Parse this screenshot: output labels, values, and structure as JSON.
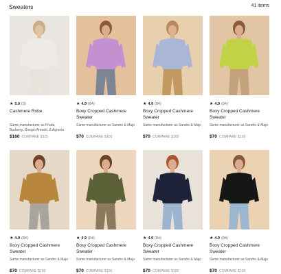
{
  "header": {
    "title": "Sweaters",
    "count": "41 items"
  },
  "products": [
    {
      "score": "5.0",
      "reviews": "(3)",
      "name": "Cashmere Robe",
      "manufacturer": "Same manufacturer as Prada, Burberry, Giorgio Armani, & Agnona",
      "price": "$160",
      "compare": "COMPARE $325",
      "colors": {
        "bg": "#e9e6e2",
        "garment": "#eeebe6",
        "skin": "#e3c1a6",
        "hair": "#c9ad87",
        "pants": "#e7e3dd"
      }
    },
    {
      "score": "4.9",
      "reviews": "(84)",
      "name": "Boxy Cropped Cashmere Sweater",
      "manufacturer": "Same manufacturer as Sandro & Majo",
      "price": "$70",
      "compare": "COMPARE $100",
      "colors": {
        "bg": "#e4c19c",
        "garment": "#c391cf",
        "skin": "#d9ad8d",
        "hair": "#8a5a3a",
        "pants": "#7b8593"
      }
    },
    {
      "score": "4.9",
      "reviews": "(84)",
      "name": "Boxy Cropped Cashmere Sweater",
      "manufacturer": "Same manufacturer as Sandro & Majo",
      "price": "$70",
      "compare": "COMPARE $100",
      "colors": {
        "bg": "#e8cfae",
        "garment": "#a9b6d6",
        "skin": "#ddb291",
        "hair": "#b8895e",
        "pants": "#c29a5f"
      }
    },
    {
      "score": "4.9",
      "reviews": "(84)",
      "name": "Boxy Cropped Cashmere Sweater",
      "manufacturer": "Same manufacturer as Sandro & Majo",
      "price": "$70",
      "compare": "COMPARE $100",
      "colors": {
        "bg": "#e2c5a4",
        "garment": "#c2d246",
        "skin": "#d9ad8d",
        "hair": "#8a5a3a",
        "pants": "#c4a37c"
      }
    },
    {
      "score": "4.9",
      "reviews": "(84)",
      "name": "Boxy Cropped Cashmere Sweater",
      "manufacturer": "Same manufacturer as Sandro & Majo",
      "price": "$70",
      "compare": "COMPARE $100",
      "colors": {
        "bg": "#e6d8c6",
        "garment": "#b9863f",
        "skin": "#d9ad8d",
        "hair": "#6d4327",
        "pants": "#a9a49d"
      }
    },
    {
      "score": "4.9",
      "reviews": "(84)",
      "name": "Boxy Cropped Cashmere Sweater",
      "manufacturer": "Same manufacturer as Sandro & Majo",
      "price": "$70",
      "compare": "COMPARE $100",
      "colors": {
        "bg": "#ecd6bd",
        "garment": "#5c6137",
        "skin": "#d9ad8d",
        "hair": "#6d4327",
        "pants": "#8b7a5c"
      }
    },
    {
      "score": "4.9",
      "reviews": "(84)",
      "name": "Boxy Cropped Cashmere Sweater",
      "manufacturer": "Same manufacturer as Sandro & Majo",
      "price": "$70",
      "compare": "COMPARE $100",
      "colors": {
        "bg": "#e9e2d8",
        "garment": "#1f2339",
        "skin": "#d9ad8d",
        "hair": "#a9552c",
        "pants": "#9db4cf"
      }
    },
    {
      "score": "4.9",
      "reviews": "(84)",
      "name": "Boxy Cropped Cashmere Sweater",
      "manufacturer": "Same manufacturer as Sandro & Majo",
      "price": "$70",
      "compare": "COMPARE $100",
      "colors": {
        "bg": "#ead2b2",
        "garment": "#161616",
        "skin": "#d9ad8d",
        "hair": "#8a5a3a",
        "pants": "#9cb6d0"
      }
    }
  ]
}
